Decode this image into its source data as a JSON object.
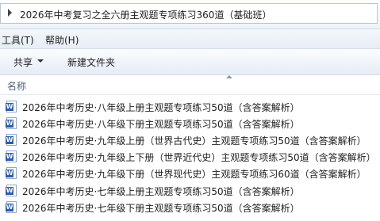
{
  "address": {
    "path": "2026年中考复习之全六册主观题专项练习360道（基础班）"
  },
  "menu": {
    "tools": "工具(T)",
    "help": "帮助(H)"
  },
  "toolbar": {
    "share": "共享",
    "new_folder": "新建文件夹"
  },
  "columns": {
    "name": "名称"
  },
  "files": [
    {
      "name": "2026年中考历史·八年级上册主观题专项练习50道（含答案解析）",
      "icon": "word-doc-icon"
    },
    {
      "name": "2026年中考历史·八年级下册主观题专项练习50道（含答案解析）",
      "icon": "word-doc-icon"
    },
    {
      "name": "2026年中考历史·九年级上册（世界古代史）主观题专项练习50道（含答案解析）",
      "icon": "word-doc-icon"
    },
    {
      "name": "2026年中考历史·九年级上下册（世界近代史）主观题专项练习50道（含答案解析）",
      "icon": "word-doc-icon"
    },
    {
      "name": "2026年中考历史·九年级下册（世界现代史）主观题专项练习60道（含答案解析）",
      "icon": "word-doc-icon"
    },
    {
      "name": "2026年中考历史·七年级上册主观题专项练习50道（含答案解析）",
      "icon": "word-doc-icon"
    },
    {
      "name": "2026年中考历史·七年级下册主观题专项练习50道（含答案解析）",
      "icon": "word-doc-icon"
    }
  ]
}
